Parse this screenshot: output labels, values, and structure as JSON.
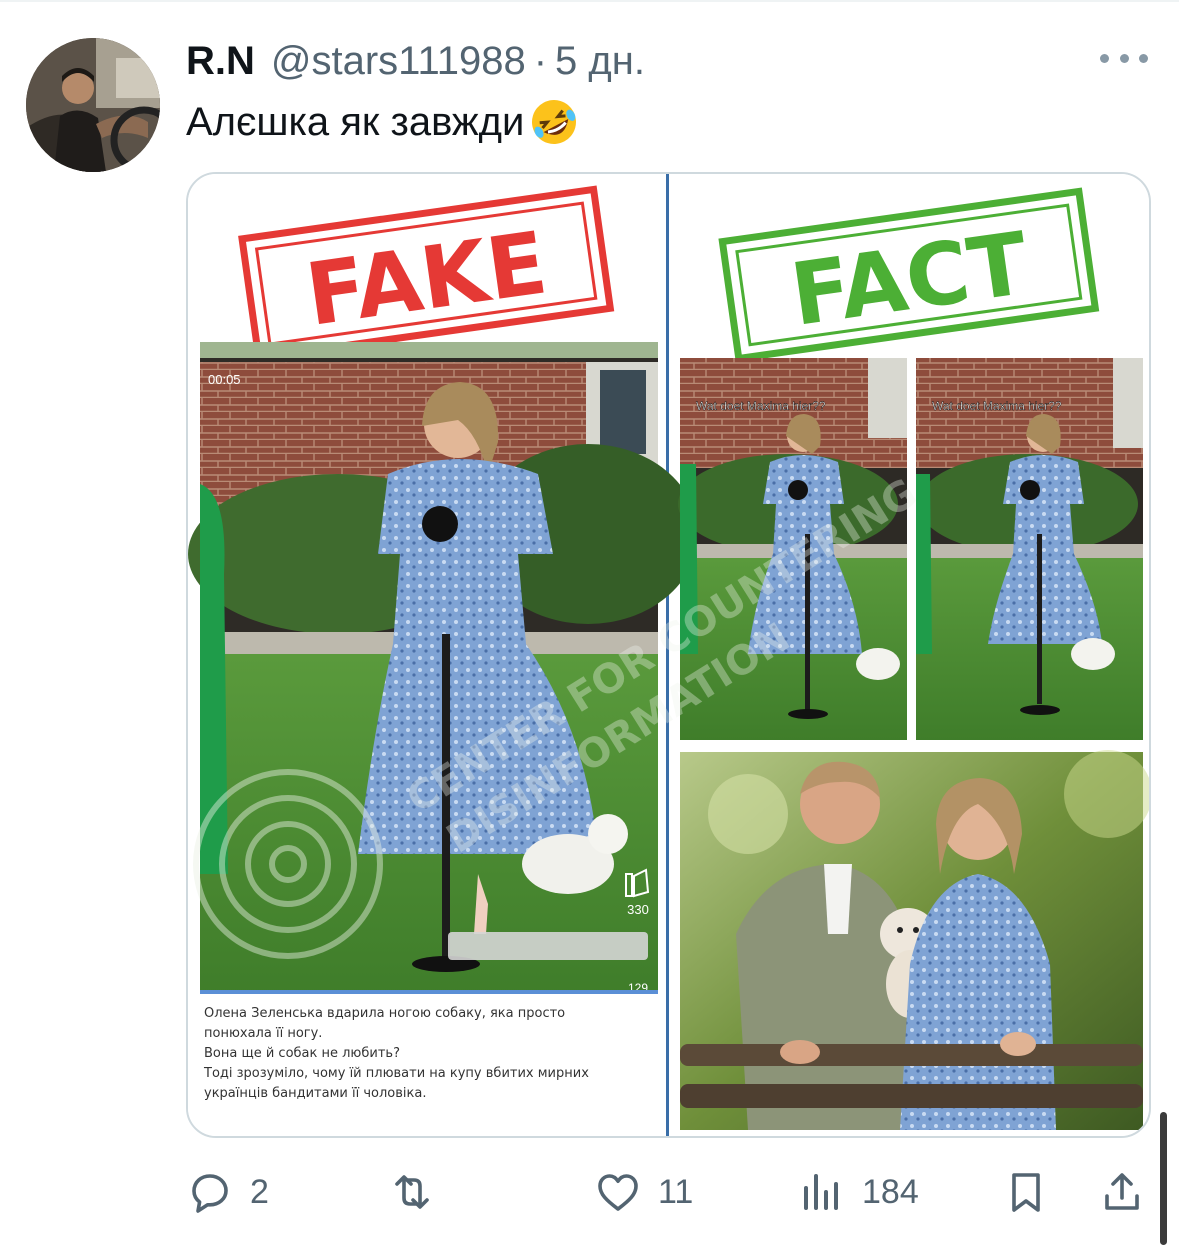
{
  "tweet": {
    "author_name": "R.N",
    "author_handle": "@stars111988",
    "separator": "·",
    "time_ago": "5 дн.",
    "text": "Алєшка як завжди"
  },
  "media": {
    "left_stamp": "FAKE",
    "right_stamp": "FACT",
    "video_time": "00:05",
    "like_count": "330",
    "comment_count": "129",
    "overlay_caption_1": "Wat doet Maxima hier??",
    "overlay_caption_2": "Wat doet Maxima hier??",
    "watermark_line1": "CENTER FOR COUNTERING",
    "watermark_line2": "DISINFORMATION",
    "caption_lines": [
      "Олена Зеленська вдарила ногою собаку, яка просто",
      "понюхала її ногу.",
      "Вона ще й собак не любить?",
      "Тоді зрозуміло, чому їй плювати на купу вбитих мирних",
      "українців бандитами її чоловіка."
    ],
    "colors": {
      "fake_red": "#e53935",
      "fact_green": "#4caf35"
    }
  },
  "actions": {
    "reply_count": "2",
    "retweet_count": "",
    "like_count": "11",
    "view_count": "184"
  },
  "icons": [
    "more-icon",
    "reply-icon",
    "retweet-icon",
    "like-icon",
    "views-icon",
    "bookmark-icon",
    "share-icon"
  ],
  "colors": {
    "secondary_text": "#536471",
    "primary_text": "#0f1419",
    "border": "#cfd9de"
  }
}
